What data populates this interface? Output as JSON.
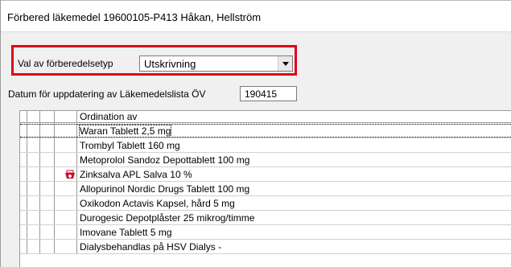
{
  "window": {
    "title": "Förbered läkemedel  19600105-P413 Håkan, Hellström"
  },
  "form": {
    "type_label": "Val av förberedelsetyp",
    "type_value": "Utskrivning",
    "date_label": "Datum för uppdatering av Läkemedelslista ÖV",
    "date_value": "190415"
  },
  "table": {
    "header": "Ordination av",
    "rows": [
      {
        "text": "Waran Tablett 2,5 mg",
        "icon": null
      },
      {
        "text": "Trombyl Tablett 160 mg",
        "icon": null
      },
      {
        "text": "Metoprolol Sandoz Depottablett 100 mg",
        "icon": null
      },
      {
        "text": "Zinksalva APL Salva 10 %",
        "icon": "medicine-icon"
      },
      {
        "text": "Allopurinol Nordic Drugs Tablett 100 mg",
        "icon": null
      },
      {
        "text": "Oxikodon Actavis Kapsel, hård 5 mg",
        "icon": null
      },
      {
        "text": "Durogesic Depotplåster 25 mikrog/timme",
        "icon": null
      },
      {
        "text": "Imovane Tablett 5 mg",
        "icon": null
      },
      {
        "text": "Dialysbehandlas på HSV Dialys -",
        "icon": null
      }
    ]
  },
  "colors": {
    "highlight": "#e2001a",
    "icon_red": "#c8102e"
  }
}
